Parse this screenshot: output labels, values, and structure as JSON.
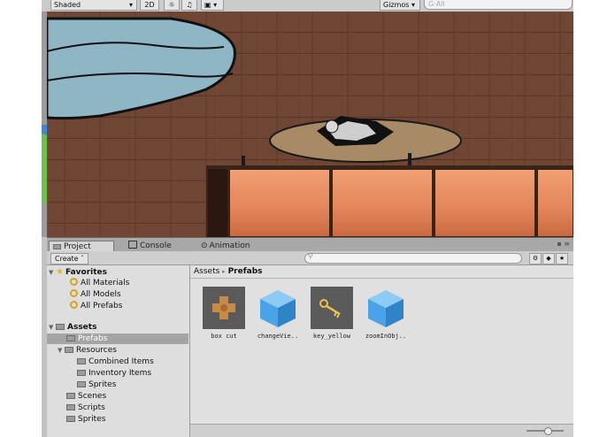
{
  "scene_toolbar": {
    "shading_mode": "Shaded",
    "mode_2d": "2D",
    "gizmos": "Gizmos",
    "search_placeholder": "G·All"
  },
  "panel_tabs": [
    {
      "label": "Project",
      "icon": "folder-icon",
      "active": true
    },
    {
      "label": "Console",
      "icon": "console-icon",
      "active": false
    },
    {
      "label": "Animation",
      "icon": "animation-icon",
      "active": false
    }
  ],
  "project_toolbar": {
    "create_label": "Create ˇ"
  },
  "favorites": {
    "label": "Favorites",
    "items": [
      "All Materials",
      "All Models",
      "All Prefabs"
    ]
  },
  "assets_tree": {
    "label": "Assets",
    "selected": "Prefabs",
    "items": [
      {
        "label": "Prefabs",
        "selected": true
      },
      {
        "label": "Resources"
      },
      {
        "label": "Combined Items"
      },
      {
        "label": "Inventory Items"
      },
      {
        "label": "Sprites"
      },
      {
        "label": "Scenes"
      },
      {
        "label": "Scripts"
      },
      {
        "label": "Sprites"
      }
    ]
  },
  "breadcrumb": {
    "root": "Assets",
    "separator": "▸",
    "current": "Prefabs"
  },
  "asset_items": [
    {
      "label": "box cut",
      "icon": "sprite-puzzle-icon"
    },
    {
      "label": "changeVie..",
      "icon": "prefab-cube-icon"
    },
    {
      "label": "key_yellow",
      "icon": "key-sprite-icon"
    },
    {
      "label": "zoomInObj..",
      "icon": "prefab-cube-icon"
    }
  ],
  "colors": {
    "floor": "#6e4633",
    "rug": "#8fb6c4",
    "table": "#a88a66",
    "cabinet": "#e08a5c",
    "selection": "#a4a4a4",
    "prefab_cube": "#4aa3e6"
  }
}
